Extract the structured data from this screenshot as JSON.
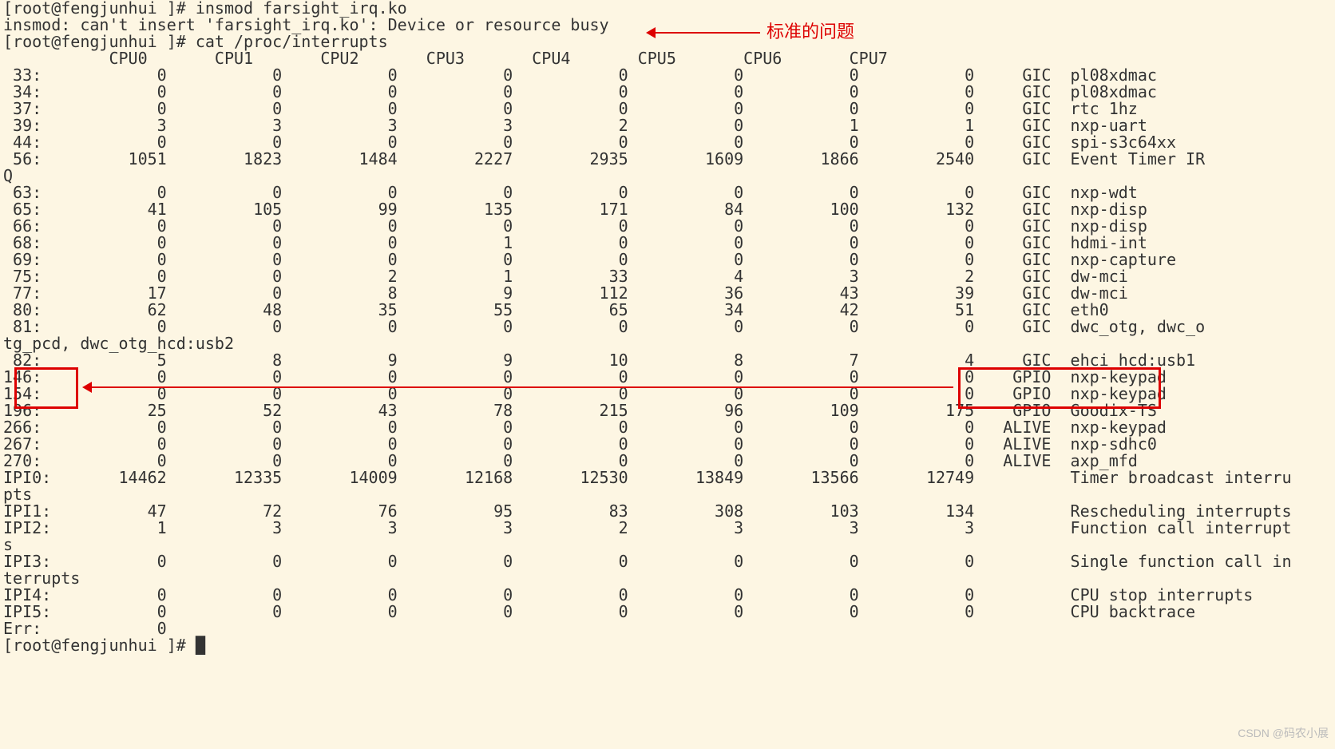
{
  "annotations": {
    "label1": "标准的问题",
    "watermark": "CSDN @码农小展"
  },
  "prompt_user": "root@fengjunhui",
  "prompt_symbol": "#",
  "cmd1": "insmod farsight_irq.ko",
  "error_line": "insmod: can't insert 'farsight_irq.ko': Device or resource busy",
  "cmd2": "cat /proc/interrupts",
  "headers": [
    "",
    "CPU0",
    "CPU1",
    "CPU2",
    "CPU3",
    "CPU4",
    "CPU5",
    "CPU6",
    "CPU7",
    "",
    ""
  ],
  "rows": [
    {
      "irq": " 33:",
      "v": [
        "0",
        "0",
        "0",
        "0",
        "0",
        "0",
        "0",
        "0"
      ],
      "ctrl": "GIC",
      "name": "pl08xdmac"
    },
    {
      "irq": " 34:",
      "v": [
        "0",
        "0",
        "0",
        "0",
        "0",
        "0",
        "0",
        "0"
      ],
      "ctrl": "GIC",
      "name": "pl08xdmac"
    },
    {
      "irq": " 37:",
      "v": [
        "0",
        "0",
        "0",
        "0",
        "0",
        "0",
        "0",
        "0"
      ],
      "ctrl": "GIC",
      "name": "rtc 1hz"
    },
    {
      "irq": " 39:",
      "v": [
        "3",
        "3",
        "3",
        "3",
        "2",
        "0",
        "1",
        "1"
      ],
      "ctrl": "GIC",
      "name": "nxp-uart"
    },
    {
      "irq": " 44:",
      "v": [
        "0",
        "0",
        "0",
        "0",
        "0",
        "0",
        "0",
        "0"
      ],
      "ctrl": "GIC",
      "name": "spi-s3c64xx"
    },
    {
      "irq": " 56:",
      "v": [
        "1051",
        "1823",
        "1484",
        "2227",
        "2935",
        "1609",
        "1866",
        "2540"
      ],
      "ctrl": "GIC",
      "name": "Event Timer IR"
    },
    {
      "irq": "Q",
      "v": [
        "",
        "",
        "",
        "",
        "",
        "",
        "",
        ""
      ],
      "ctrl": "",
      "name": ""
    },
    {
      "irq": " 63:",
      "v": [
        "0",
        "0",
        "0",
        "0",
        "0",
        "0",
        "0",
        "0"
      ],
      "ctrl": "GIC",
      "name": "nxp-wdt"
    },
    {
      "irq": " 65:",
      "v": [
        "41",
        "105",
        "99",
        "135",
        "171",
        "84",
        "100",
        "132"
      ],
      "ctrl": "GIC",
      "name": "nxp-disp"
    },
    {
      "irq": " 66:",
      "v": [
        "0",
        "0",
        "0",
        "0",
        "0",
        "0",
        "0",
        "0"
      ],
      "ctrl": "GIC",
      "name": "nxp-disp"
    },
    {
      "irq": " 68:",
      "v": [
        "0",
        "0",
        "0",
        "1",
        "0",
        "0",
        "0",
        "0"
      ],
      "ctrl": "GIC",
      "name": "hdmi-int"
    },
    {
      "irq": " 69:",
      "v": [
        "0",
        "0",
        "0",
        "0",
        "0",
        "0",
        "0",
        "0"
      ],
      "ctrl": "GIC",
      "name": "nxp-capture"
    },
    {
      "irq": " 75:",
      "v": [
        "0",
        "0",
        "2",
        "1",
        "33",
        "4",
        "3",
        "2"
      ],
      "ctrl": "GIC",
      "name": "dw-mci"
    },
    {
      "irq": " 77:",
      "v": [
        "17",
        "0",
        "8",
        "9",
        "112",
        "36",
        "43",
        "39"
      ],
      "ctrl": "GIC",
      "name": "dw-mci"
    },
    {
      "irq": " 80:",
      "v": [
        "62",
        "48",
        "35",
        "55",
        "65",
        "34",
        "42",
        "51"
      ],
      "ctrl": "GIC",
      "name": "eth0"
    },
    {
      "irq": " 81:",
      "v": [
        "0",
        "0",
        "0",
        "0",
        "0",
        "0",
        "0",
        "0"
      ],
      "ctrl": "GIC",
      "name": "dwc_otg, dwc_o"
    },
    {
      "irq": "tg_pcd, dwc_otg_hcd:usb2",
      "v": [
        "",
        "",
        "",
        "",
        "",
        "",
        "",
        ""
      ],
      "ctrl": "",
      "name": ""
    },
    {
      "irq": " 82:",
      "v": [
        "5",
        "8",
        "9",
        "9",
        "10",
        "8",
        "7",
        "4"
      ],
      "ctrl": "GIC",
      "name": "ehci_hcd:usb1"
    },
    {
      "irq": "146:",
      "v": [
        "0",
        "0",
        "0",
        "0",
        "0",
        "0",
        "0",
        "0"
      ],
      "ctrl": "GPIO",
      "name": "nxp-keypad"
    },
    {
      "irq": "154:",
      "v": [
        "0",
        "0",
        "0",
        "0",
        "0",
        "0",
        "0",
        "0"
      ],
      "ctrl": "GPIO",
      "name": "nxp-keypad"
    },
    {
      "irq": "196:",
      "v": [
        "25",
        "52",
        "43",
        "78",
        "215",
        "96",
        "109",
        "175"
      ],
      "ctrl": "GPIO",
      "name": "Goodix-TS"
    },
    {
      "irq": "266:",
      "v": [
        "0",
        "0",
        "0",
        "0",
        "0",
        "0",
        "0",
        "0"
      ],
      "ctrl": "ALIVE",
      "name": "nxp-keypad"
    },
    {
      "irq": "267:",
      "v": [
        "0",
        "0",
        "0",
        "0",
        "0",
        "0",
        "0",
        "0"
      ],
      "ctrl": "ALIVE",
      "name": "nxp-sdhc0"
    },
    {
      "irq": "270:",
      "v": [
        "0",
        "0",
        "0",
        "0",
        "0",
        "0",
        "0",
        "0"
      ],
      "ctrl": "ALIVE",
      "name": "axp_mfd"
    },
    {
      "irq": "IPI0:",
      "v": [
        "14462",
        "12335",
        "14009",
        "12168",
        "12530",
        "13849",
        "13566",
        "12749"
      ],
      "ctrl": "",
      "name": "Timer broadcast interru"
    },
    {
      "irq": "pts",
      "v": [
        "",
        "",
        "",
        "",
        "",
        "",
        "",
        ""
      ],
      "ctrl": "",
      "name": ""
    },
    {
      "irq": "IPI1:",
      "v": [
        "47",
        "72",
        "76",
        "95",
        "83",
        "308",
        "103",
        "134"
      ],
      "ctrl": "",
      "name": "Rescheduling interrupts"
    },
    {
      "irq": "IPI2:",
      "v": [
        "1",
        "3",
        "3",
        "3",
        "2",
        "3",
        "3",
        "3"
      ],
      "ctrl": "",
      "name": "Function call interrupt"
    },
    {
      "irq": "s",
      "v": [
        "",
        "",
        "",
        "",
        "",
        "",
        "",
        ""
      ],
      "ctrl": "",
      "name": ""
    },
    {
      "irq": "IPI3:",
      "v": [
        "0",
        "0",
        "0",
        "0",
        "0",
        "0",
        "0",
        "0"
      ],
      "ctrl": "",
      "name": "Single function call in"
    },
    {
      "irq": "terrupts",
      "v": [
        "",
        "",
        "",
        "",
        "",
        "",
        "",
        ""
      ],
      "ctrl": "",
      "name": ""
    },
    {
      "irq": "IPI4:",
      "v": [
        "0",
        "0",
        "0",
        "0",
        "0",
        "0",
        "0",
        "0"
      ],
      "ctrl": "",
      "name": "CPU stop interrupts"
    },
    {
      "irq": "IPI5:",
      "v": [
        "0",
        "0",
        "0",
        "0",
        "0",
        "0",
        "0",
        "0"
      ],
      "ctrl": "",
      "name": "CPU backtrace"
    },
    {
      "irq": "Err:",
      "v": [
        "0",
        "",
        "",
        "",
        "",
        "",
        "",
        ""
      ],
      "ctrl": "",
      "name": ""
    }
  ],
  "final_prompt": "[root@fengjunhui ]# "
}
